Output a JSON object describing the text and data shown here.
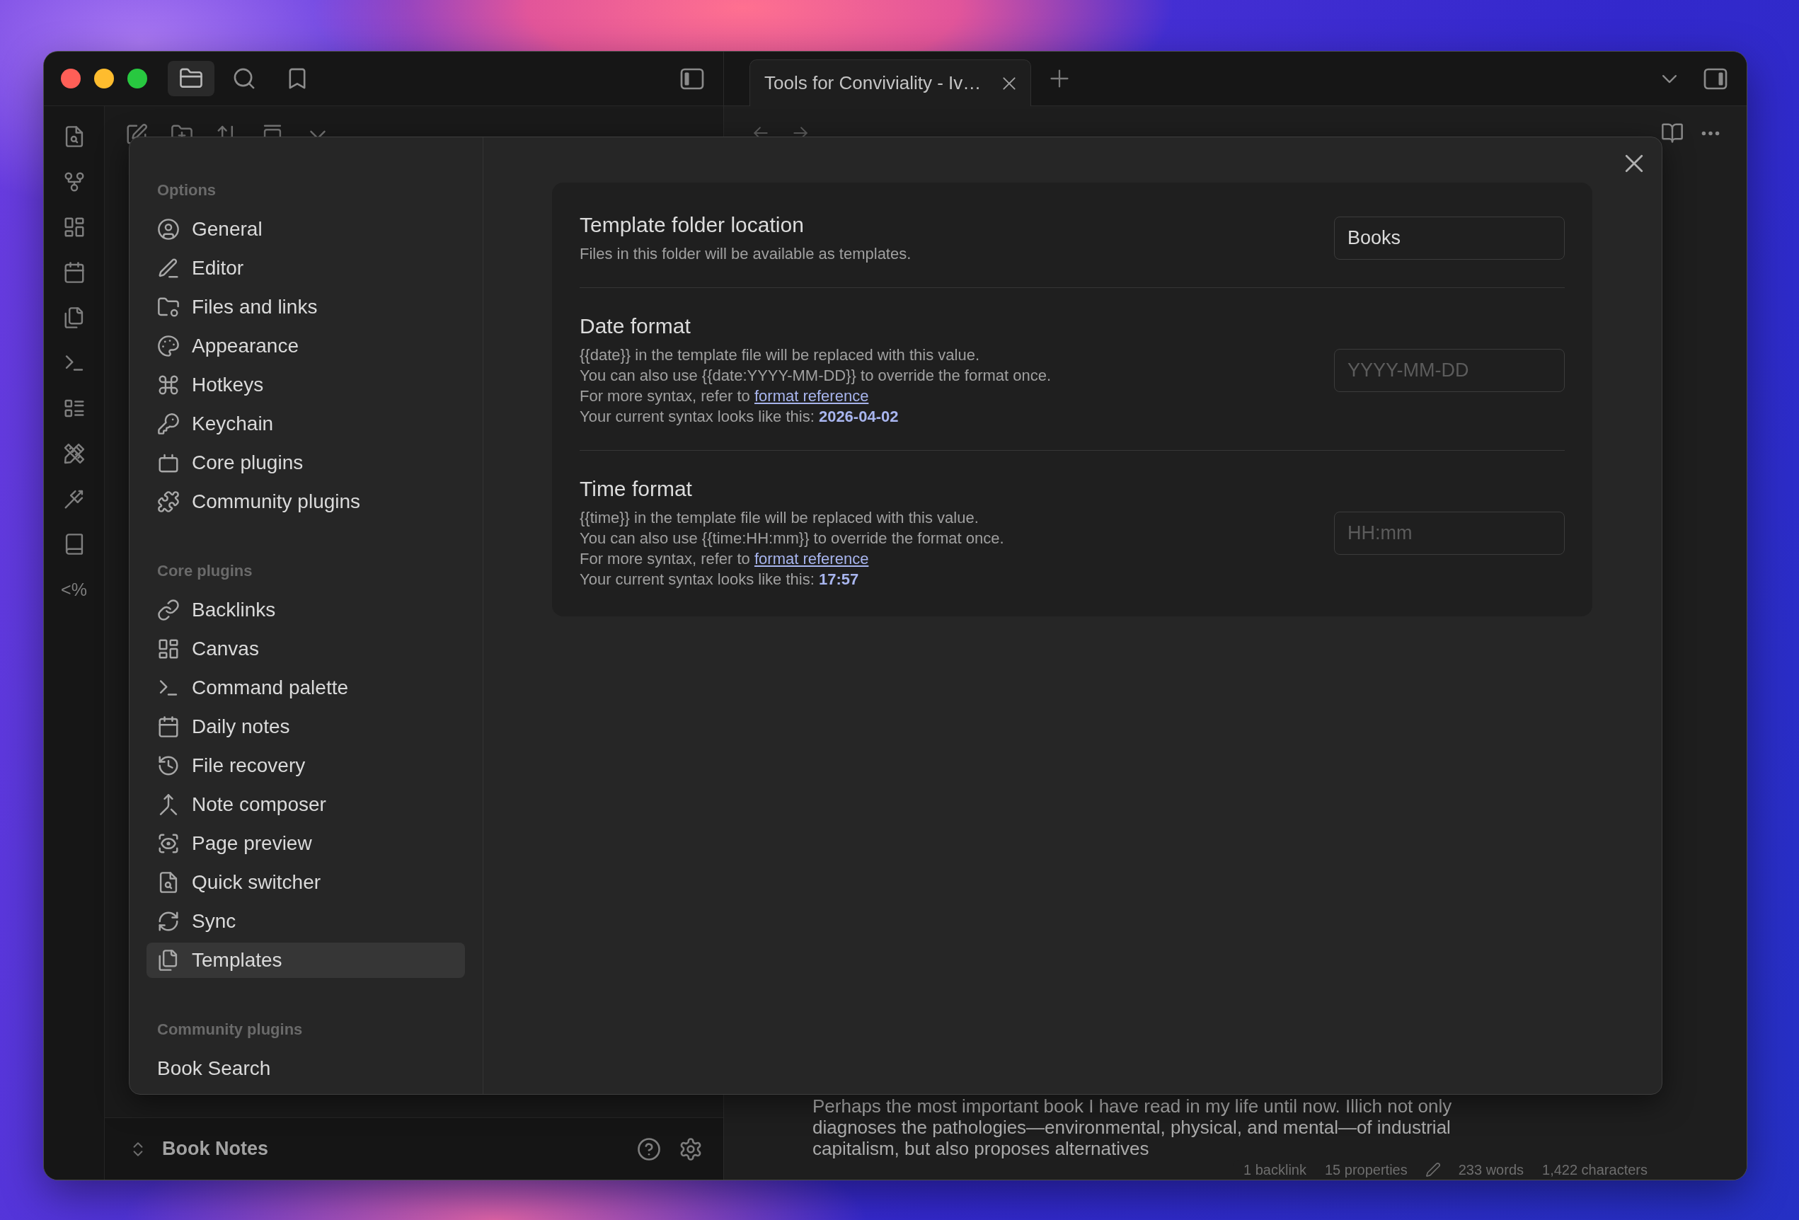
{
  "title_bar": {
    "panel_tabs": [
      {
        "selected": true
      },
      {
        "selected": false
      },
      {
        "selected": false
      }
    ]
  },
  "ribbon": {
    "text_button": "<%"
  },
  "tabs": [
    {
      "label": "Tools for Conviviality - Iv…",
      "selected": true
    }
  ],
  "file_explorer": {
    "vault_name": "Book Notes"
  },
  "editor": {
    "paragraph": "Perhaps the most important book I have read in my life until now. Illich not only diagnoses the pathologies—environmental, physical, and mental—of industrial capitalism, but also proposes alternatives"
  },
  "status_bar": {
    "backlinks": "1 backlink",
    "properties": "15 properties",
    "words": "233 words",
    "characters": "1,422 characters"
  },
  "settings_modal": {
    "sidebar": [
      {
        "title": "Options",
        "items": [
          {
            "label": "General",
            "selected": false
          },
          {
            "label": "Editor",
            "selected": false
          },
          {
            "label": "Files and links",
            "selected": false
          },
          {
            "label": "Appearance",
            "selected": false
          },
          {
            "label": "Hotkeys",
            "selected": false
          },
          {
            "label": "Keychain",
            "selected": false
          },
          {
            "label": "Core plugins",
            "selected": false
          },
          {
            "label": "Community plugins",
            "selected": false
          }
        ]
      },
      {
        "title": "Core plugins",
        "items": [
          {
            "label": "Backlinks",
            "selected": false
          },
          {
            "label": "Canvas",
            "selected": false
          },
          {
            "label": "Command palette",
            "selected": false
          },
          {
            "label": "Daily notes",
            "selected": false
          },
          {
            "label": "File recovery",
            "selected": false
          },
          {
            "label": "Note composer",
            "selected": false
          },
          {
            "label": "Page preview",
            "selected": false
          },
          {
            "label": "Quick switcher",
            "selected": false
          },
          {
            "label": "Sync",
            "selected": false
          },
          {
            "label": "Templates",
            "selected": true
          }
        ]
      },
      {
        "title": "Community plugins",
        "items": [
          {
            "label": "Book Search",
            "selected": false
          }
        ]
      }
    ],
    "settings": [
      {
        "name": "Template folder location",
        "description": [
          "Files in this folder will be available as templates."
        ],
        "field": {
          "value": "Books"
        }
      },
      {
        "name": "Date format",
        "description": [
          "{{date}} in the template file will be replaced with this value.",
          "You can also use {{date:YYYY-MM-DD}} to override the format once."
        ],
        "syntax_note": {
          "text": "For more syntax, refer to",
          "link": "format reference"
        },
        "current": "Your current syntax looks like this: **2026-04-02**",
        "field": {
          "placeholder": "YYYY-MM-DD"
        }
      },
      {
        "name": "Time format",
        "description": [
          "{{time}} in the template file will be replaced with this value.",
          "You can also use {{time:HH:mm}} to override the format once."
        ],
        "syntax_note": {
          "text": "For more syntax, refer to",
          "link": "format reference"
        },
        "current": "Your current syntax looks like this: **17:57**",
        "field": {
          "placeholder": "HH:mm"
        }
      }
    ]
  }
}
